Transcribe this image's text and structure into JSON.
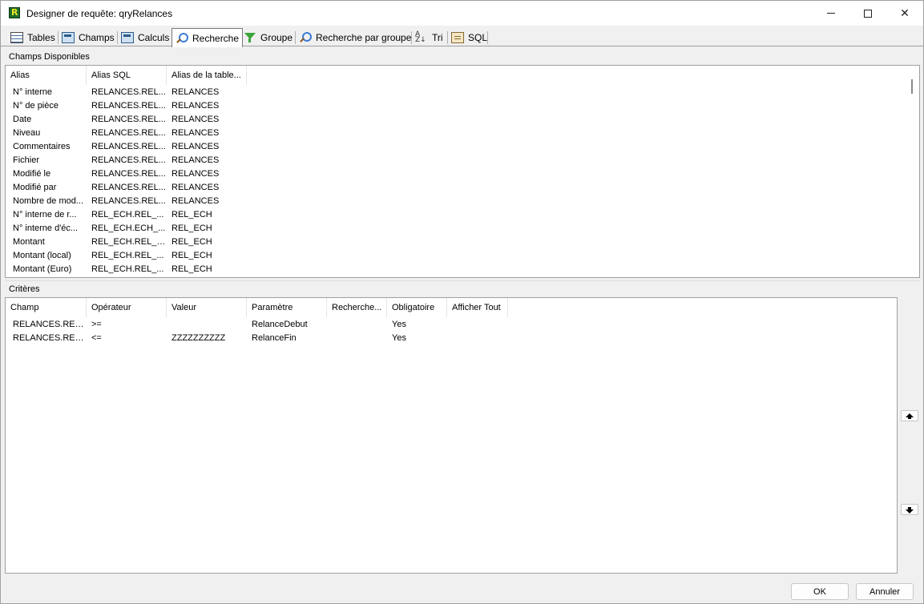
{
  "window": {
    "title": "Designer de requête: qryRelances"
  },
  "tabs": [
    {
      "label": "Tables",
      "icon": "table-icon"
    },
    {
      "label": "Champs",
      "icon": "calculator-icon"
    },
    {
      "label": "Calculs",
      "icon": "calculator-icon"
    },
    {
      "label": "Recherche",
      "icon": "search-icon",
      "active": true
    },
    {
      "label": "Groupe",
      "icon": "filter-icon"
    },
    {
      "label": "Recherche par groupe",
      "icon": "group-search-icon"
    },
    {
      "label": "Tri",
      "icon": "sort-az-icon"
    },
    {
      "label": "SQL",
      "icon": "sql-icon"
    }
  ],
  "available_fields": {
    "label": "Champs Disponibles",
    "columns": [
      "Alias",
      "Alias SQL",
      "Alias de la table..."
    ],
    "rows": [
      [
        "N° interne",
        "RELANCES.REL...",
        "RELANCES"
      ],
      [
        "N° de pièce",
        "RELANCES.REL...",
        "RELANCES"
      ],
      [
        "Date",
        "RELANCES.REL...",
        "RELANCES"
      ],
      [
        "Niveau",
        "RELANCES.REL...",
        "RELANCES"
      ],
      [
        "Commentaires",
        "RELANCES.REL...",
        "RELANCES"
      ],
      [
        "Fichier",
        "RELANCES.REL...",
        "RELANCES"
      ],
      [
        "Modifié le",
        "RELANCES.REL...",
        "RELANCES"
      ],
      [
        "Modifié par",
        "RELANCES.REL...",
        "RELANCES"
      ],
      [
        "Nombre de mod...",
        "RELANCES.REL...",
        "RELANCES"
      ],
      [
        "N° interne de r...",
        "REL_ECH.REL_...",
        "REL_ECH"
      ],
      [
        "N° interne d'éc...",
        "REL_ECH.ECH_...",
        "REL_ECH"
      ],
      [
        "Montant",
        "REL_ECH.REL_MT",
        "REL_ECH"
      ],
      [
        "Montant (local)",
        "REL_ECH.REL_...",
        "REL_ECH"
      ],
      [
        "Montant (Euro)",
        "REL_ECH.REL_...",
        "REL_ECH"
      ]
    ]
  },
  "criteria": {
    "label": "Critères",
    "columns": [
      "Champ",
      "Opérateur",
      "Valeur",
      "Paramètre",
      "Recherche...",
      "Obligatoire",
      "Afficher Tout"
    ],
    "rows": [
      [
        "RELANCES.REL...",
        ">=",
        "",
        "RelanceDebut",
        "",
        "Yes",
        ""
      ],
      [
        "RELANCES.REL...",
        "<=",
        "ZZZZZZZZZZ",
        "RelanceFin",
        "",
        "Yes",
        ""
      ]
    ]
  },
  "buttons": {
    "ok": "OK",
    "cancel": "Annuler"
  }
}
